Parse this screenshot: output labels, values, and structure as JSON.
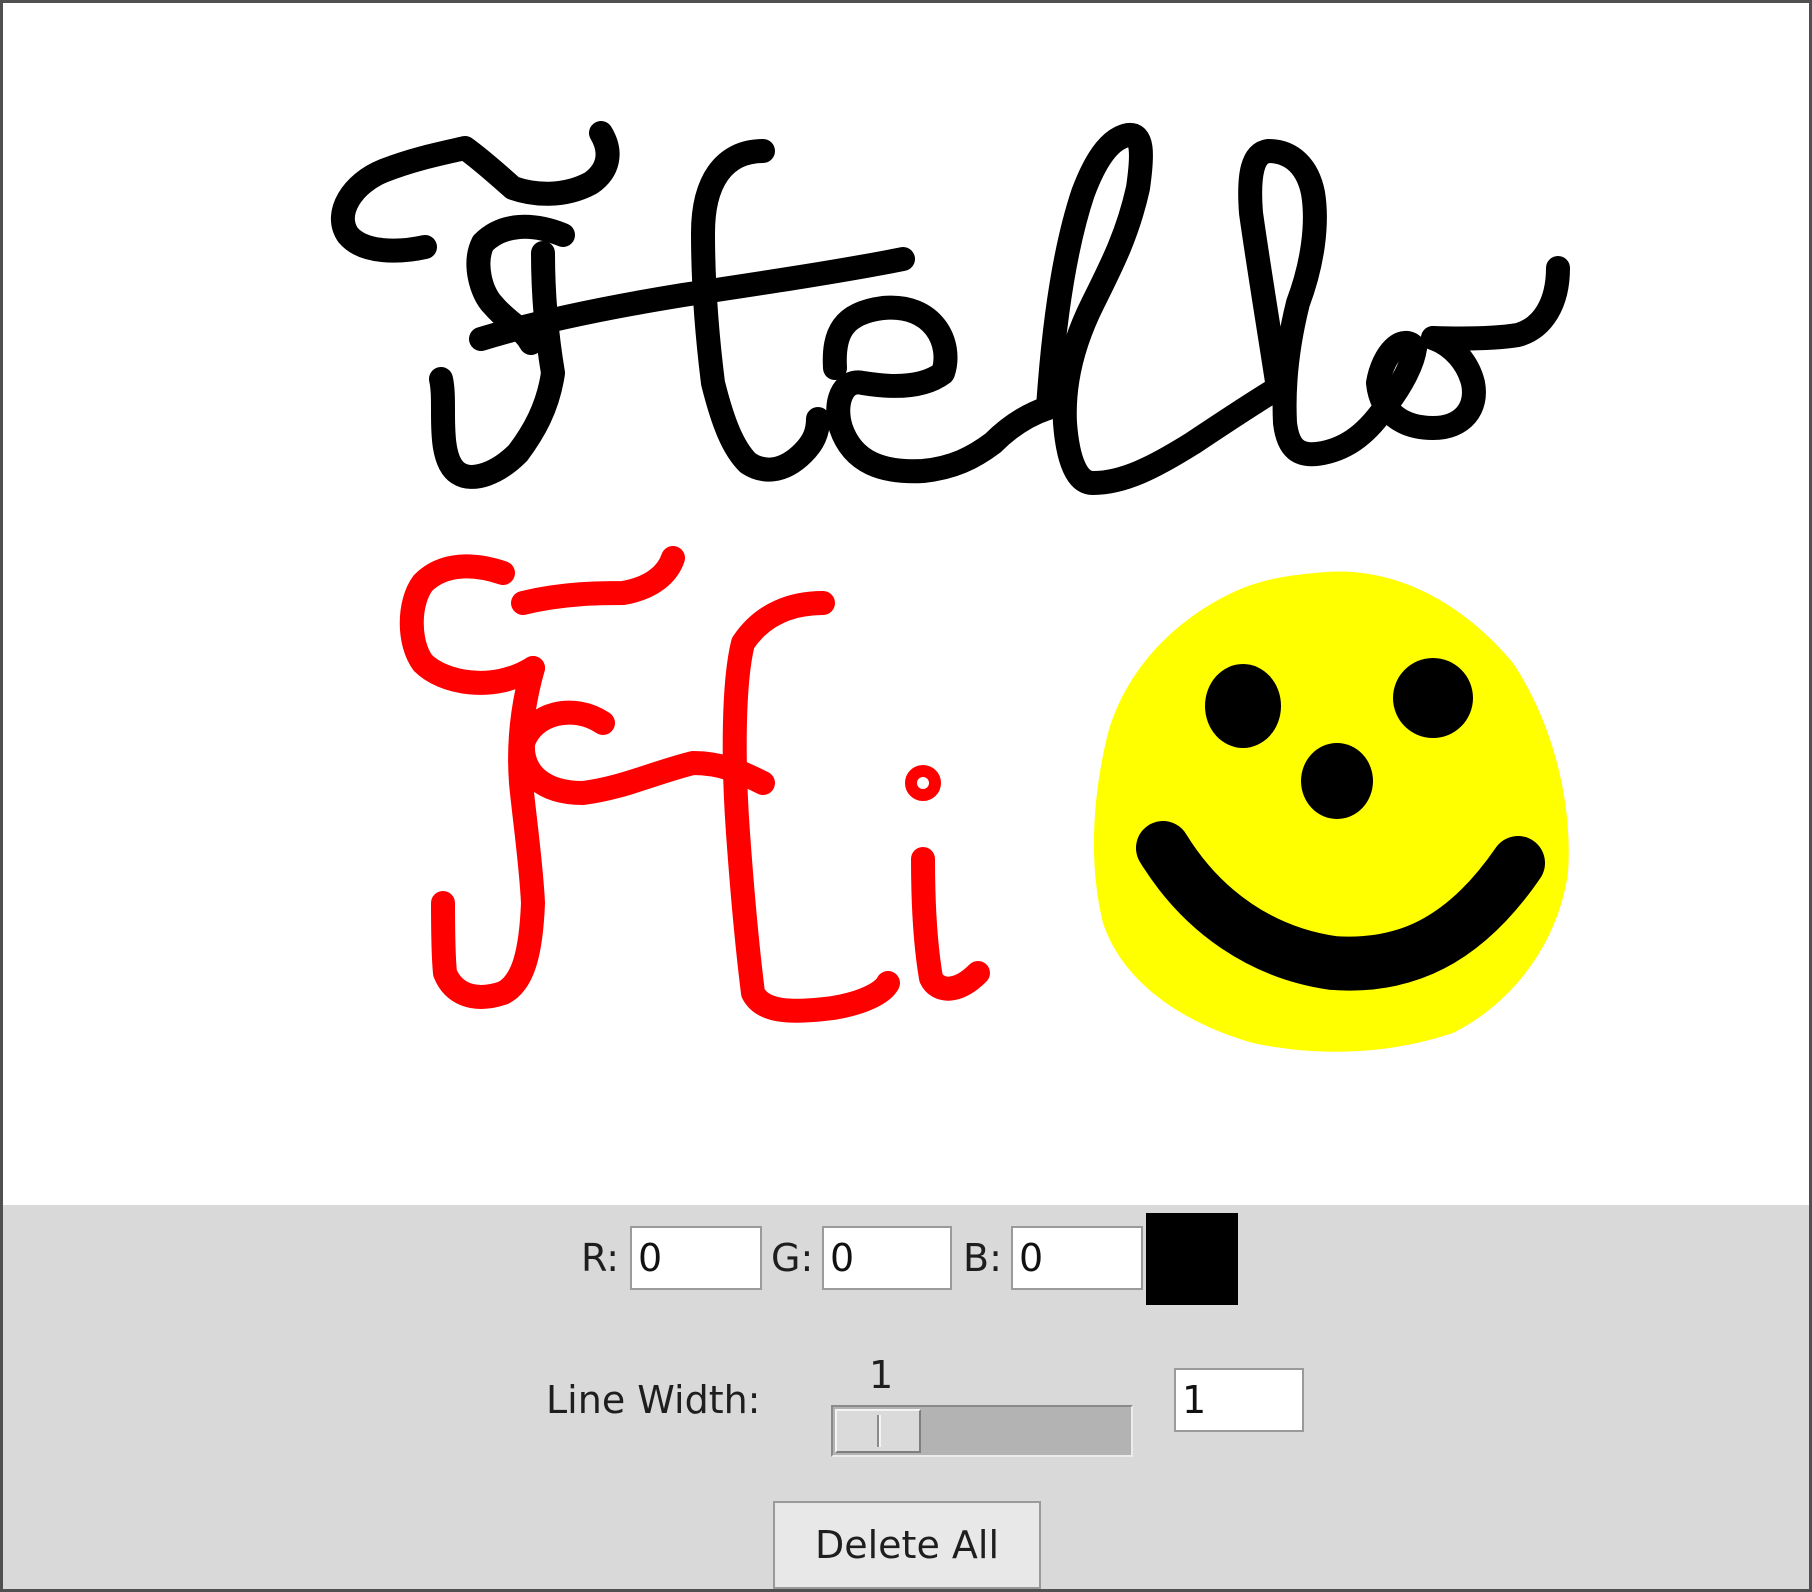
{
  "controls": {
    "r_label": "R:",
    "r_value": "0",
    "g_label": "G:",
    "g_value": "0",
    "b_label": "B:",
    "b_value": "0",
    "current_color": "#000000",
    "line_width_label": "Line Width:",
    "slider_value": "1",
    "line_width_value": "1",
    "delete_all_label": "Delete All"
  },
  "drawing": {
    "stroke_colors": [
      "#000000",
      "#ff0000",
      "#ffff00"
    ]
  }
}
